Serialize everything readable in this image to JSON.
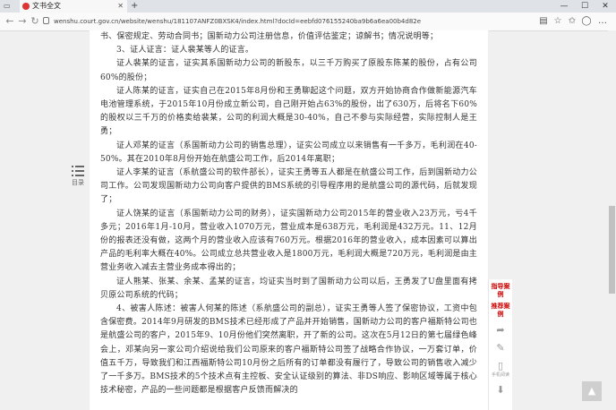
{
  "browser": {
    "tab_title": "文书全文",
    "url": "wenshu.court.gov.cn/website/wenshu/181107ANFZ0BXSK4/index.html?docId=eebfd076155240ba9b6a6ea00b4d82e"
  },
  "toc": {
    "label": "目录"
  },
  "document": {
    "paragraphs": [
      {
        "indent": false,
        "text": "书、保密规定、劳动合同书；国新动力公司注册信息，价值评估鉴定；谅解书；情况说明等；"
      },
      {
        "indent": true,
        "text": "3、证人证言：证人裴某等人的证言。"
      },
      {
        "indent": true,
        "text": "证人裴某的证言，证实其系国新动力公司的新股东，以三千万购买了原股东陈某的股份，占有公司60%的股份；"
      },
      {
        "indent": true,
        "text": "证人陈某的证言，证实自己在2015年8月份和王勇聊起这个问题，双方开始协商合作做新能源汽车电池管理系统，于2015年10月份成立新公司，自己刚开始占63%的股份，出了630万，后将名下60%的股权以三千万的价格卖给裴某，公司的利润大概是30-40%，自己不参与实际经营，实际控制人是王勇；"
      },
      {
        "indent": true,
        "text": "证人邓某的证言（系国新动力公司的销售总理），证实公司成立以来销售有一千多万，毛利润在40-50%。其在2010年8月份开始在航盛公司工作，后2014年离职；"
      },
      {
        "indent": true,
        "text": "证人李某的证言（系航盛公司的软件部长），证实王勇等五人都是在航盛公司工作，后到国新动力公司工作。公司发现国新动力公司向客户提供的BMS系统的引导程序用的是航盛公司的源代码，后就发现了；"
      },
      {
        "indent": true,
        "text": "证人饶某的证言（系国新动力公司的财务），证实国新动力公司2015年的营业收入23万元，亏4千多元；2016年1月-10月，营业收入1070万元，营业成本是638万元，毛利润是432万元。11、12月份的报表还没有做，这两个月的营业收入应该有760万元。根据2016年的营业收入，成本因素可以算出产品的毛利率大概在40%。公司成立总共营业收入是1800万元，毛利润大概是720万元，毛利润是由主营业务收入减去主营业务成本得出的；"
      },
      {
        "indent": true,
        "text": "证人熊某、张某、余某、孟某的证言，均证实当时到了国新动力公司以后，王勇发了U盘里面有拷贝原公司系统的代码；"
      },
      {
        "indent": true,
        "text": "4、被害人陈述：被害人何某的陈述（系航盛公司的副总），证实王勇等人签了保密协议，工资中包含保密费。2014年9月研发的BMS技术已经形成了产品并开始销售，国新动力公司的客户福斯特公司也是航盛公司的客户，2015年9、10月份他们突然离职，开了新的公司。这次在5月12日的第七届绿色峰会上，邓某向另一家公司介绍说给我们公司原来的客户福斯特公司签了战略合作协议，一万套订单，价值五千万，导致我们和江西福斯特公司10月份之后所有的订单都没有履行了，导致公司的销售收入减少了一千多万。BMS技术的5个技术点有主控板、安全认证级别的算法、非DS响应、影响区域等属于核心技术秘密，产品的一些问题都是根据客户反馈而解决的"
      }
    ]
  },
  "sidebar": {
    "link1": "指导案例",
    "link2": "推荐案例",
    "share_label": "分享",
    "print_label": "打印",
    "mobile_label": "手机阅读"
  },
  "totop_label": "返回顶部"
}
